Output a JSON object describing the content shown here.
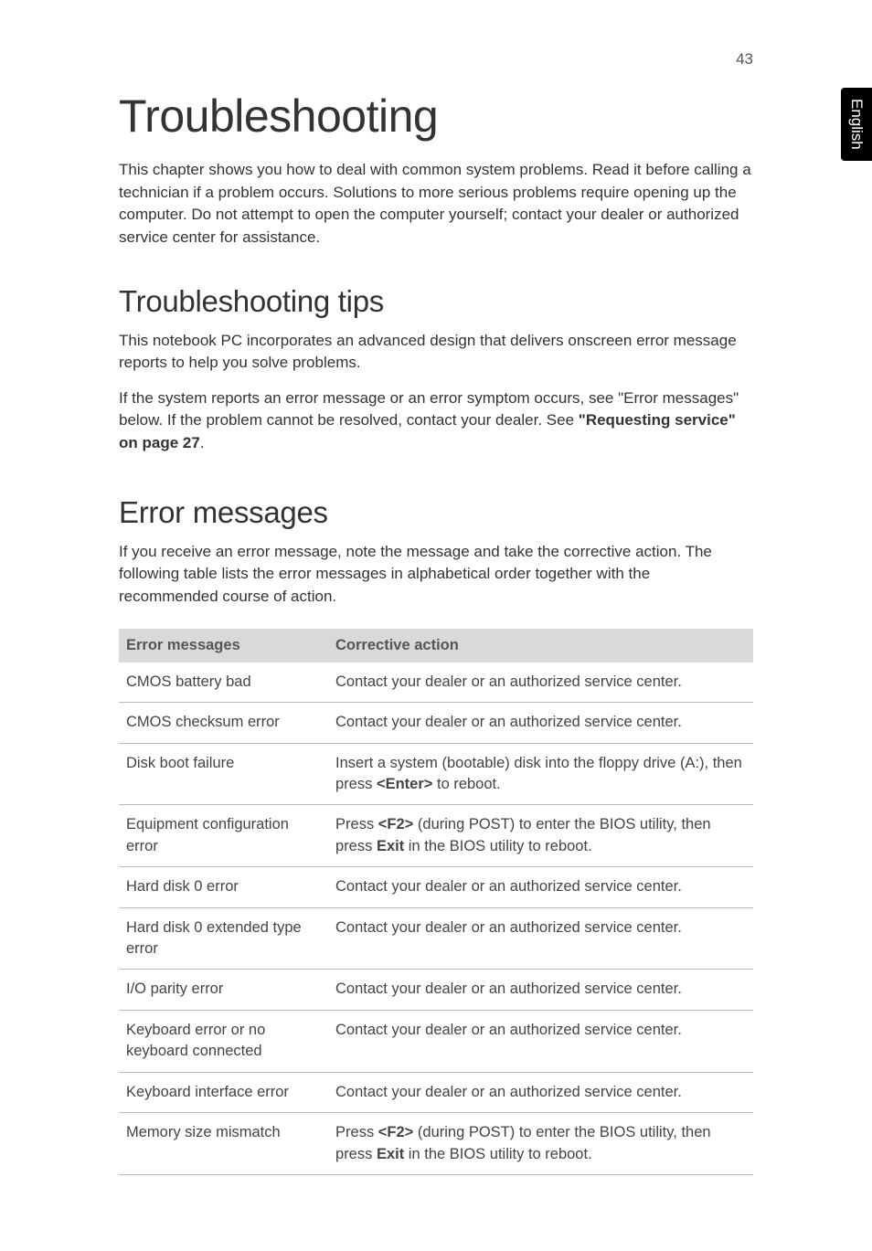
{
  "page_number": "43",
  "side_tab": "English",
  "title": "Troubleshooting",
  "intro": "This chapter shows you how to deal with common system problems. Read it before calling a technician if a problem occurs. Solutions to more serious problems require opening up the computer. Do not attempt to open the computer yourself; contact your dealer or authorized service center for assistance.",
  "section1": {
    "heading": "Troubleshooting tips",
    "p1": "This notebook PC incorporates an advanced design that delivers onscreen error message reports to help you solve problems.",
    "p2_a": "If the system reports an error message or an error symptom occurs, see \"Error messages\" below. If the problem cannot be resolved, contact your dealer. See ",
    "p2_bold": "\"Requesting service\" on page 27",
    "p2_b": "."
  },
  "section2": {
    "heading": "Error messages",
    "p1": "If you receive an error message, note the message and take the corrective action. The following table lists the error messages in alphabetical order together with the recommended course of action."
  },
  "table": {
    "headers": [
      "Error messages",
      "Corrective action"
    ],
    "rows": [
      {
        "c0": "CMOS battery bad",
        "c1": "Contact your dealer or an authorized service center."
      },
      {
        "c0": "CMOS checksum error",
        "c1": "Contact your dealer or an authorized service center."
      },
      {
        "c0": "Disk boot failure",
        "c1_a": "Insert a system (bootable) disk into the floppy drive (A:), then press ",
        "c1_b1": "<Enter>",
        "c1_c": " to reboot."
      },
      {
        "c0": "Equipment configuration error",
        "c1_a": "Press ",
        "c1_b1": "<F2>",
        "c1_c": " (during POST) to enter the BIOS utility, then press ",
        "c1_b2": "Exit",
        "c1_d": " in the BIOS utility to reboot."
      },
      {
        "c0": "Hard disk 0 error",
        "c1": "Contact your dealer or an authorized service center."
      },
      {
        "c0": "Hard disk 0 extended type error",
        "c1": "Contact your dealer or an authorized service center."
      },
      {
        "c0": "I/O parity error",
        "c1": "Contact your dealer or an authorized service center."
      },
      {
        "c0": "Keyboard error or no keyboard connected",
        "c1": "Contact your dealer or an authorized service center."
      },
      {
        "c0": "Keyboard interface error",
        "c1": "Contact your dealer or an authorized service center."
      },
      {
        "c0": "Memory size mismatch",
        "c1_a": "Press ",
        "c1_b1": "<F2>",
        "c1_c": " (during POST) to enter the BIOS utility, then press ",
        "c1_b2": "Exit",
        "c1_d": " in the BIOS utility to reboot."
      }
    ]
  }
}
